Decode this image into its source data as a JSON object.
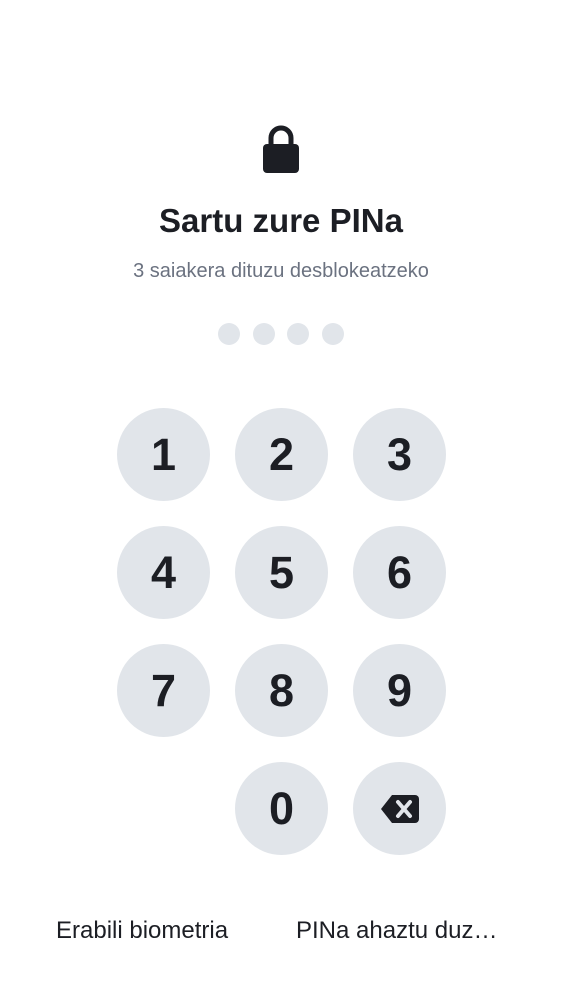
{
  "icons": {
    "lock": "lock-icon",
    "backspace": "backspace-icon"
  },
  "colors": {
    "text": "#1c1e24",
    "subtext": "#6b7280",
    "key_bg": "#e1e5ea",
    "dot_empty": "#e1e5ea"
  },
  "header": {
    "title": "Sartu zure PINa",
    "subtitle": "3 saiakera dituzu desblokeatzeko"
  },
  "pin": {
    "length": 4,
    "entered": 0
  },
  "keypad": {
    "keys": [
      "1",
      "2",
      "3",
      "4",
      "5",
      "6",
      "7",
      "8",
      "9",
      "0"
    ]
  },
  "footer": {
    "biometric_label": "Erabili biometria",
    "forgot_label": "PINa ahaztu duz…"
  }
}
